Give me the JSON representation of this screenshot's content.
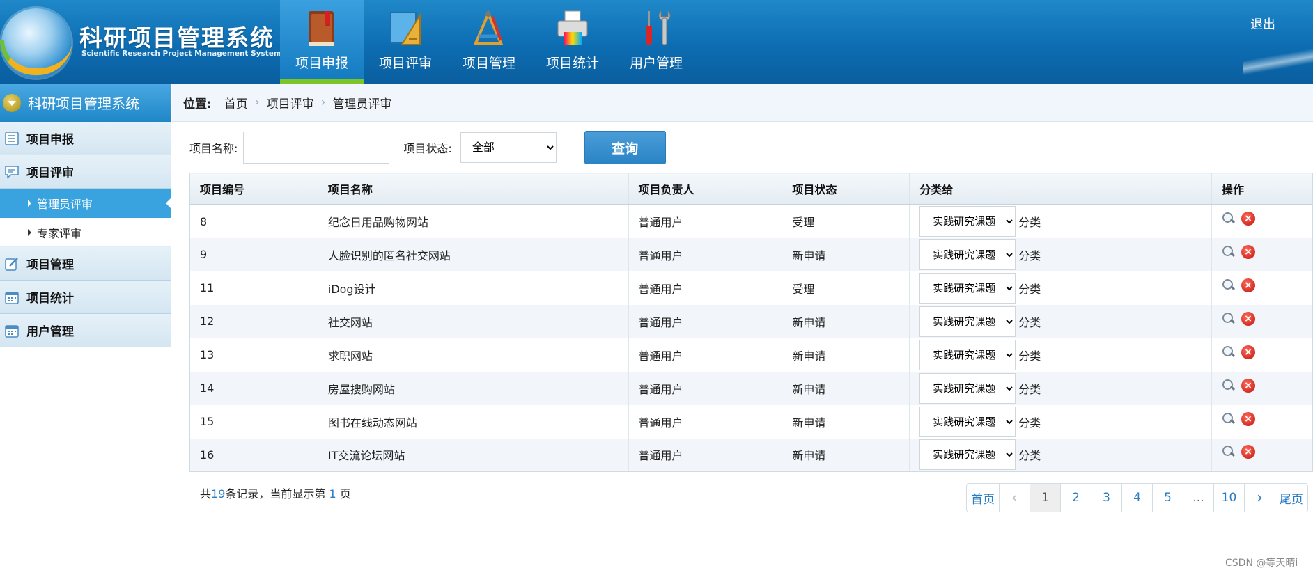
{
  "header": {
    "title": "科研项目管理系统",
    "subtitle": "Scientific Research Project Management System",
    "logout": "退出",
    "nav": [
      {
        "label": "项目申报",
        "icon": "book-icon",
        "active": true
      },
      {
        "label": "项目评审",
        "icon": "ruler-icon",
        "active": false
      },
      {
        "label": "项目管理",
        "icon": "tools-icon",
        "active": false
      },
      {
        "label": "项目统计",
        "icon": "printer-icon",
        "active": false
      },
      {
        "label": "用户管理",
        "icon": "wrench-icon",
        "active": false
      }
    ]
  },
  "sidebar": {
    "title": "科研项目管理系统",
    "sections": [
      {
        "label": "项目申报",
        "icon": "list-icon"
      },
      {
        "label": "项目评审",
        "icon": "comment-icon",
        "children": [
          {
            "label": "管理员评审",
            "active": true
          },
          {
            "label": "专家评审",
            "active": false
          }
        ]
      },
      {
        "label": "项目管理",
        "icon": "edit-icon"
      },
      {
        "label": "项目统计",
        "icon": "calendar-icon"
      },
      {
        "label": "用户管理",
        "icon": "calendar-icon"
      }
    ]
  },
  "breadcrumb": {
    "label": "位置:",
    "items": [
      "首页",
      "项目评审",
      "管理员评审"
    ],
    "separator": "›"
  },
  "search": {
    "name_label": "项目名称:",
    "name_value": "",
    "status_label": "项目状态:",
    "status_value": "全部",
    "button": "查询"
  },
  "table": {
    "headers": [
      "项目编号",
      "项目名称",
      "项目负责人",
      "项目状态",
      "分类给",
      "操作"
    ],
    "category_option": "实践研究课题",
    "category_suffix": "分类",
    "rows": [
      {
        "id": "8",
        "name": "纪念日用品购物网站",
        "owner": "普通用户",
        "status": "受理"
      },
      {
        "id": "9",
        "name": "人脸识别的匿名社交网站",
        "owner": "普通用户",
        "status": "新申请"
      },
      {
        "id": "11",
        "name": "iDog设计",
        "owner": "普通用户",
        "status": "受理"
      },
      {
        "id": "12",
        "name": "社交网站",
        "owner": "普通用户",
        "status": "新申请"
      },
      {
        "id": "13",
        "name": "求职网站",
        "owner": "普通用户",
        "status": "新申请"
      },
      {
        "id": "14",
        "name": "房屋搜购网站",
        "owner": "普通用户",
        "status": "新申请"
      },
      {
        "id": "15",
        "name": "图书在线动态网站",
        "owner": "普通用户",
        "status": "新申请"
      },
      {
        "id": "16",
        "name": "IT交流论坛网站",
        "owner": "普通用户",
        "status": "新申请"
      }
    ]
  },
  "summary": {
    "prefix": "共",
    "total": "19",
    "middle": "条记录，当前显示第 ",
    "page": "1",
    "suffix": " 页"
  },
  "pager": {
    "first": "首页",
    "prev": "‹",
    "pages": [
      "1",
      "2",
      "3",
      "4",
      "5"
    ],
    "ellipsis": "...",
    "last_page": "10",
    "next": "›",
    "last": "尾页",
    "current": "1"
  },
  "watermark": "CSDN @等天晴i",
  "colors": {
    "header_blue": "#0d6db2",
    "active_green": "#7cc427",
    "link_blue": "#2a7dc2",
    "delete_red": "#c0140c"
  }
}
